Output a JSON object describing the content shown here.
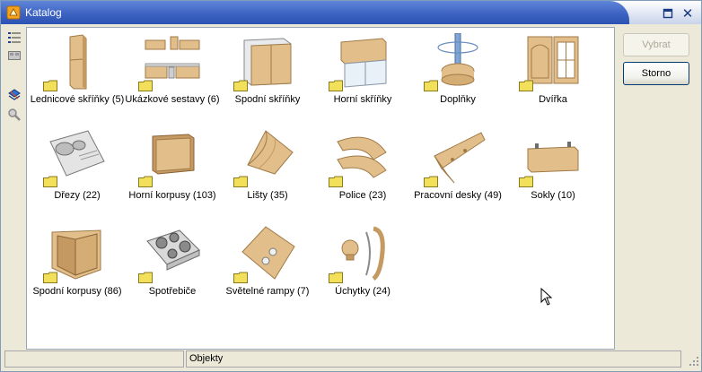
{
  "window": {
    "title": "Katalog"
  },
  "title_controls": {
    "restore_icon": "restore-icon",
    "close_icon": "close-icon",
    "close_glyph": "✕"
  },
  "left_toolbar": {
    "items": [
      {
        "icon": "details-view-icon"
      },
      {
        "icon": "thumbnail-view-icon"
      },
      {
        "icon": "catalog-edit-icon"
      },
      {
        "icon": "search-icon"
      }
    ]
  },
  "catalog": {
    "items": [
      {
        "label": "Lednicové skříňky (5)",
        "icon": "tall-cabinet-icon"
      },
      {
        "label": "Ukázkové sestavy (6)",
        "icon": "kitchen-set-icon"
      },
      {
        "label": "Spodní skříňky",
        "icon": "base-cabinet-icon"
      },
      {
        "label": "Horní skříňky",
        "icon": "wall-cabinet-icon"
      },
      {
        "label": "Doplňky",
        "icon": "accessories-icon"
      },
      {
        "label": "Dvířka",
        "icon": "door-icon"
      },
      {
        "label": "Dřezy (22)",
        "icon": "sink-icon"
      },
      {
        "label": "Horní korpusy (103)",
        "icon": "upper-carcass-icon"
      },
      {
        "label": "Lišty (35)",
        "icon": "molding-icon"
      },
      {
        "label": "Police (23)",
        "icon": "shelf-icon"
      },
      {
        "label": "Pracovní desky (49)",
        "icon": "worktop-icon"
      },
      {
        "label": "Sokly (10)",
        "icon": "plinth-icon"
      },
      {
        "label": "Spodní korpusy (86)",
        "icon": "lower-carcass-icon"
      },
      {
        "label": "Spotřebiče",
        "icon": "cooktop-icon"
      },
      {
        "label": "Světelné rampy (7)",
        "icon": "light-ramp-icon"
      },
      {
        "label": "Úchytky (24)",
        "icon": "handle-icon"
      }
    ]
  },
  "buttons": {
    "select_label": "Vybrat",
    "cancel_label": "Storno"
  },
  "statusbar": {
    "left_text": "",
    "right_text": "Objekty"
  },
  "colors": {
    "title_bar": "#3d63c2",
    "wood": "#d8b07a",
    "folder": "#f3e05a"
  }
}
